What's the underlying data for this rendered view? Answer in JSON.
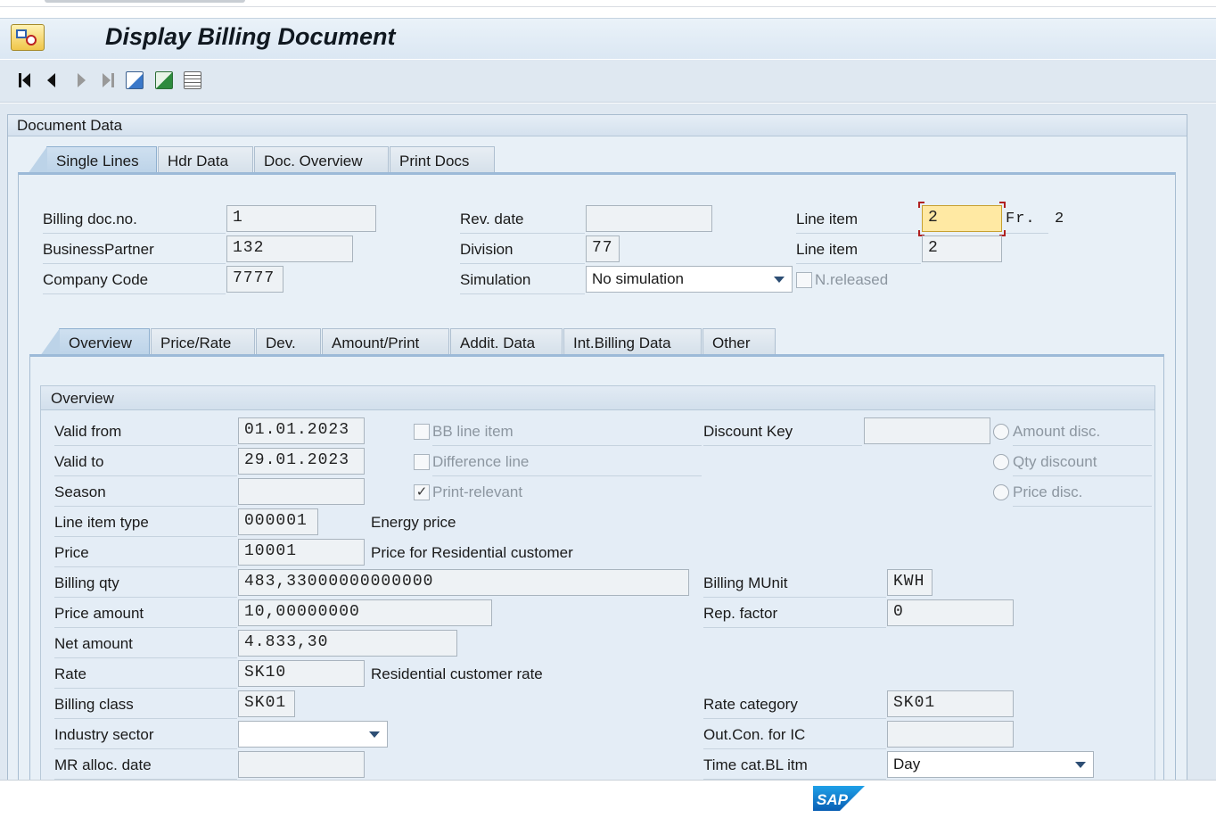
{
  "title": "Display Billing Document",
  "document_data": {
    "group_title": "Document Data",
    "tabs": [
      "Single Lines",
      "Hdr Data",
      "Doc. Overview",
      "Print Docs"
    ],
    "fields": {
      "billing_doc_no": {
        "label": "Billing doc.no.",
        "value": "1"
      },
      "business_partner": {
        "label": "BusinessPartner",
        "value": "132"
      },
      "company_code": {
        "label": "Company Code",
        "value": "7777"
      },
      "rev_date": {
        "label": "Rev. date",
        "value": ""
      },
      "division": {
        "label": "Division",
        "value": "77"
      },
      "simulation": {
        "label": "Simulation",
        "value": "No simulation"
      },
      "n_released": {
        "label": "N.released",
        "checked": false
      },
      "line_item_1": {
        "label": "Line item",
        "value": "2",
        "from_label": "Fr.",
        "from_value": "2"
      },
      "line_item_2": {
        "label": "Line item",
        "value": "2"
      }
    }
  },
  "sub_tabs": [
    "Overview",
    "Price/Rate",
    "Dev.",
    "Amount/Print",
    "Addit. Data",
    "Int.Billing Data",
    "Other"
  ],
  "overview": {
    "title": "Overview",
    "valid_from": {
      "label": "Valid from",
      "value": "01.01.2023"
    },
    "valid_to": {
      "label": "Valid to",
      "value": "29.01.2023"
    },
    "season": {
      "label": "Season",
      "value": ""
    },
    "line_item_type": {
      "label": "Line item type",
      "value": "000001",
      "text": "Energy price"
    },
    "price": {
      "label": "Price",
      "value": "10001",
      "text": "Price for Residential customer"
    },
    "billing_qty": {
      "label": "Billing qty",
      "value": "483,33000000000000"
    },
    "price_amount": {
      "label": "Price amount",
      "value": "10,00000000"
    },
    "net_amount": {
      "label": "Net amount",
      "value": "4.833,30"
    },
    "rate": {
      "label": "Rate",
      "value": "SK10",
      "text": "Residential customer rate"
    },
    "billing_class": {
      "label": "Billing class",
      "value": "SK01"
    },
    "industry_sector": {
      "label": "Industry sector",
      "value": ""
    },
    "mr_alloc_date": {
      "label": "MR alloc. date",
      "value": ""
    },
    "bb_line_item": {
      "label": "BB line item",
      "checked": false
    },
    "difference_line": {
      "label": "Difference line",
      "checked": false
    },
    "print_relevant": {
      "label": "Print-relevant",
      "checked": true
    },
    "discount_key": {
      "label": "Discount Key",
      "value": ""
    },
    "amount_disc": {
      "label": "Amount disc."
    },
    "qty_discount": {
      "label": "Qty discount"
    },
    "price_disc": {
      "label": "Price disc."
    },
    "billing_munit": {
      "label": "Billing MUnit",
      "value": "KWH"
    },
    "rep_factor": {
      "label": "Rep. factor",
      "value": "0"
    },
    "rate_category": {
      "label": "Rate category",
      "value": "SK01"
    },
    "out_con_ic": {
      "label": "Out.Con. for IC",
      "value": ""
    },
    "time_cat_bl_itm": {
      "label": "Time cat.BL itm",
      "value": "Day"
    }
  },
  "logo": "SAP",
  "icons": [
    "first-page-icon",
    "previous-page-icon",
    "next-page-icon",
    "last-page-icon",
    "search-document-icon",
    "excel-export-icon",
    "layout-list-icon"
  ],
  "colors": {
    "accent": "#0a6ed1",
    "focus_field": "#ffe9a3",
    "background": "#dfe8f1"
  }
}
